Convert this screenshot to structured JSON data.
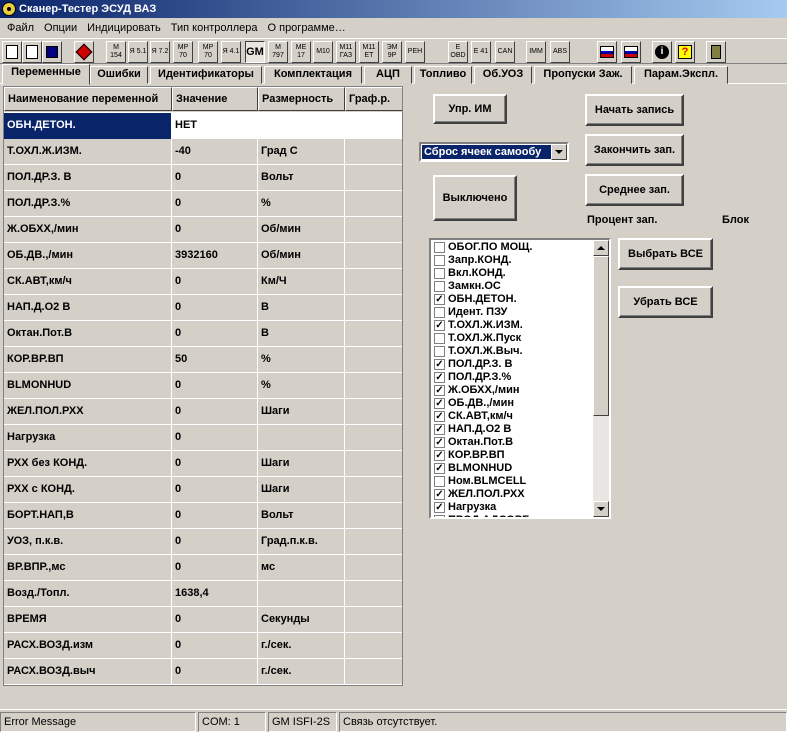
{
  "window": {
    "title": "Сканер-Тестер  ЭСУД ВАЗ"
  },
  "menu": [
    "Файл",
    "Опции",
    "Индицировать",
    "Тип контроллера",
    "О программе…"
  ],
  "toolbar": [
    {
      "id": "new",
      "label": ""
    },
    {
      "id": "open",
      "label": ""
    },
    {
      "id": "save",
      "label": ""
    },
    {
      "id": "tools",
      "label": ""
    },
    {
      "id": "m154",
      "label": "M 154"
    },
    {
      "id": "ya51",
      "label": "Я 5.1"
    },
    {
      "id": "ya72",
      "label": "Я 7.2"
    },
    {
      "id": "mp70a",
      "label": "MP 70"
    },
    {
      "id": "mp70b",
      "label": "MP 70"
    },
    {
      "id": "ya41",
      "label": "Я 4.1"
    },
    {
      "id": "gm",
      "label": "GM"
    },
    {
      "id": "m797",
      "label": "M 797"
    },
    {
      "id": "me17",
      "label": "ME 17"
    },
    {
      "id": "m10",
      "label": "M10"
    },
    {
      "id": "m11ga3",
      "label": "M11 ГАЗ"
    },
    {
      "id": "m11et",
      "label": "M11 ET"
    },
    {
      "id": "em9r",
      "label": "ЭМ 9Р"
    },
    {
      "id": "reh",
      "label": "РЕН"
    },
    {
      "id": "eobd",
      "label": "Е OBD"
    },
    {
      "id": "eu41",
      "label": "Е 41"
    },
    {
      "id": "can",
      "label": "CAN"
    },
    {
      "id": "imm",
      "label": "IMM"
    },
    {
      "id": "abs",
      "label": "ABS"
    },
    {
      "id": "chart1",
      "label": ""
    },
    {
      "id": "chart2",
      "label": ""
    },
    {
      "id": "info",
      "label": ""
    },
    {
      "id": "help",
      "label": ""
    },
    {
      "id": "exit",
      "label": ""
    }
  ],
  "tabs": [
    "Переменные",
    "Ошибки",
    "Идентификаторы",
    "Комплектация",
    "АЦП",
    "Топливо",
    "Об.УОЗ",
    "Пропуски Заж.",
    "Парам.Экспл."
  ],
  "grid": {
    "headers": [
      "Наименование переменной",
      "Значение",
      "Размерность",
      "Граф.р."
    ],
    "rows": [
      [
        "ОБН.ДЕТОН.",
        "НЕТ",
        ""
      ],
      [
        "Т.ОХЛ.Ж.ИЗМ.",
        "-40",
        "Град С"
      ],
      [
        "ПОЛ.ДР.З. В",
        "0",
        "Вольт"
      ],
      [
        "ПОЛ.ДР.З.%",
        "0",
        "%"
      ],
      [
        "Ж.ОБХХ,/мин",
        "0",
        "Об/мин"
      ],
      [
        "ОБ.ДВ.,/мин",
        "3932160",
        "Об/мин"
      ],
      [
        "СК.АВТ,км/ч",
        "0",
        "Км/Ч"
      ],
      [
        "НАП.Д.О2 В",
        "0",
        "В"
      ],
      [
        "Октан.Пот.В",
        "0",
        "В"
      ],
      [
        "КОР.ВР.ВП",
        "50",
        " %"
      ],
      [
        "BLMONHUD",
        "0",
        " %"
      ],
      [
        "ЖЕЛ.ПОЛ.РХХ",
        "0",
        "Шаги"
      ],
      [
        "Нагрузка",
        "0",
        ""
      ],
      [
        "РХХ без КОНД.",
        "0",
        "Шаги"
      ],
      [
        "РХХ с КОНД.",
        "0",
        "Шаги"
      ],
      [
        "БОРТ.НАП,В",
        "0",
        "Вольт"
      ],
      [
        "УОЗ, п.к.в.",
        "0",
        "Град.п.к.в."
      ],
      [
        "ВР.ВПР.,мс",
        "0",
        "мс"
      ],
      [
        "Возд./Топл.",
        "1638,4",
        ""
      ],
      [
        "ВРЕМЯ",
        "0",
        "Секунды"
      ],
      [
        "РАСХ.ВОЗД.изм",
        "0",
        "г./сек."
      ],
      [
        "РАСХ.ВОЗД.выч",
        "0",
        "г./сек."
      ]
    ]
  },
  "buttons": {
    "upr_im": "Упр. ИМ",
    "start_rec": "Начать запись",
    "stop_rec": "Закончить зап.",
    "avg_rec": "Среднее зап.",
    "off": "Выключено",
    "select_all": "Выбрать ВСЕ",
    "remove_all": "Убрать ВСЕ"
  },
  "combo": {
    "value": "Сброс ячеек самообу"
  },
  "labels": {
    "percent": "Процент зап.",
    "block": "Блок"
  },
  "checklist": [
    {
      "label": "ОБОГ.ПО МОЩ.",
      "checked": false
    },
    {
      "label": "Запр.КОНД.",
      "checked": false
    },
    {
      "label": "Вкл.КОНД.",
      "checked": false
    },
    {
      "label": "Замкн.ОС",
      "checked": false
    },
    {
      "label": "ОБН.ДЕТОН.",
      "checked": true
    },
    {
      "label": "Идент. ПЗУ",
      "checked": false
    },
    {
      "label": "Т.ОХЛ.Ж.ИЗМ.",
      "checked": true
    },
    {
      "label": "Т.ОХЛ.Ж.Пуск",
      "checked": false
    },
    {
      "label": "Т.ОХЛ.Ж.Выч.",
      "checked": false
    },
    {
      "label": "ПОЛ.ДР.З. В",
      "checked": true
    },
    {
      "label": "ПОЛ.ДР.З.%",
      "checked": true
    },
    {
      "label": "Ж.ОБХХ,/мин",
      "checked": true
    },
    {
      "label": "ОБ.ДВ.,/мин",
      "checked": true
    },
    {
      "label": "СК.АВТ,км/ч",
      "checked": true
    },
    {
      "label": "НАП.Д.О2 В",
      "checked": true
    },
    {
      "label": "Октан.Пот.В",
      "checked": true
    },
    {
      "label": "КОР.ВР.ВП",
      "checked": true
    },
    {
      "label": "BLMONHUD",
      "checked": true
    },
    {
      "label": "Ном.BLMCELL",
      "checked": false
    },
    {
      "label": "ЖЕЛ.ПОЛ.РХХ",
      "checked": true
    },
    {
      "label": "Нагрузка",
      "checked": true
    },
    {
      "label": "ПРОД.АДСОРБ",
      "checked": false
    }
  ],
  "status": [
    "Error Message",
    "COM: 1",
    "GM ISFI-2S",
    "Связь отсутствует."
  ]
}
